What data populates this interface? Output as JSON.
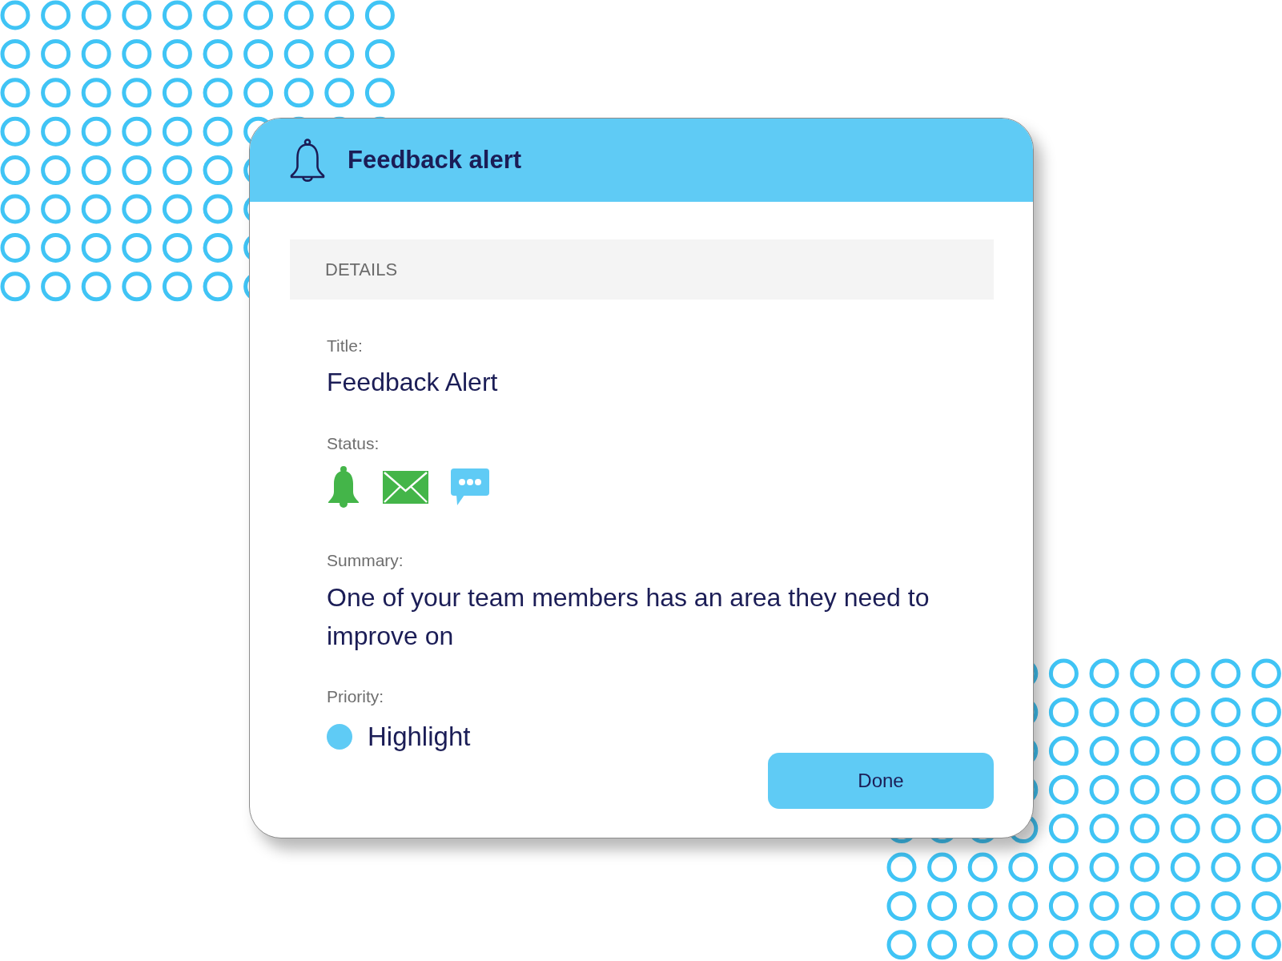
{
  "alert": {
    "title": "Feedback alert"
  },
  "details": {
    "heading": "DETAILS",
    "fields": [
      {
        "kind": "value",
        "label": "Title:",
        "value": "Feedback Alert"
      },
      {
        "kind": "icons",
        "label": "Status:",
        "icons": [
          {
            "kind": "bell",
            "color": "#44b549"
          },
          {
            "kind": "envelope",
            "color": "#44b549"
          },
          {
            "kind": "chat",
            "color": "#5fcbf5"
          }
        ]
      },
      {
        "kind": "paragraph",
        "label": "Summary:",
        "value": "One of your team members has an area they need to improve on"
      },
      {
        "kind": "priority",
        "label": "Priority:",
        "value": "Highlight",
        "color": "#5fcbf5"
      }
    ]
  },
  "buttons": [
    {
      "label": "Done"
    }
  ]
}
